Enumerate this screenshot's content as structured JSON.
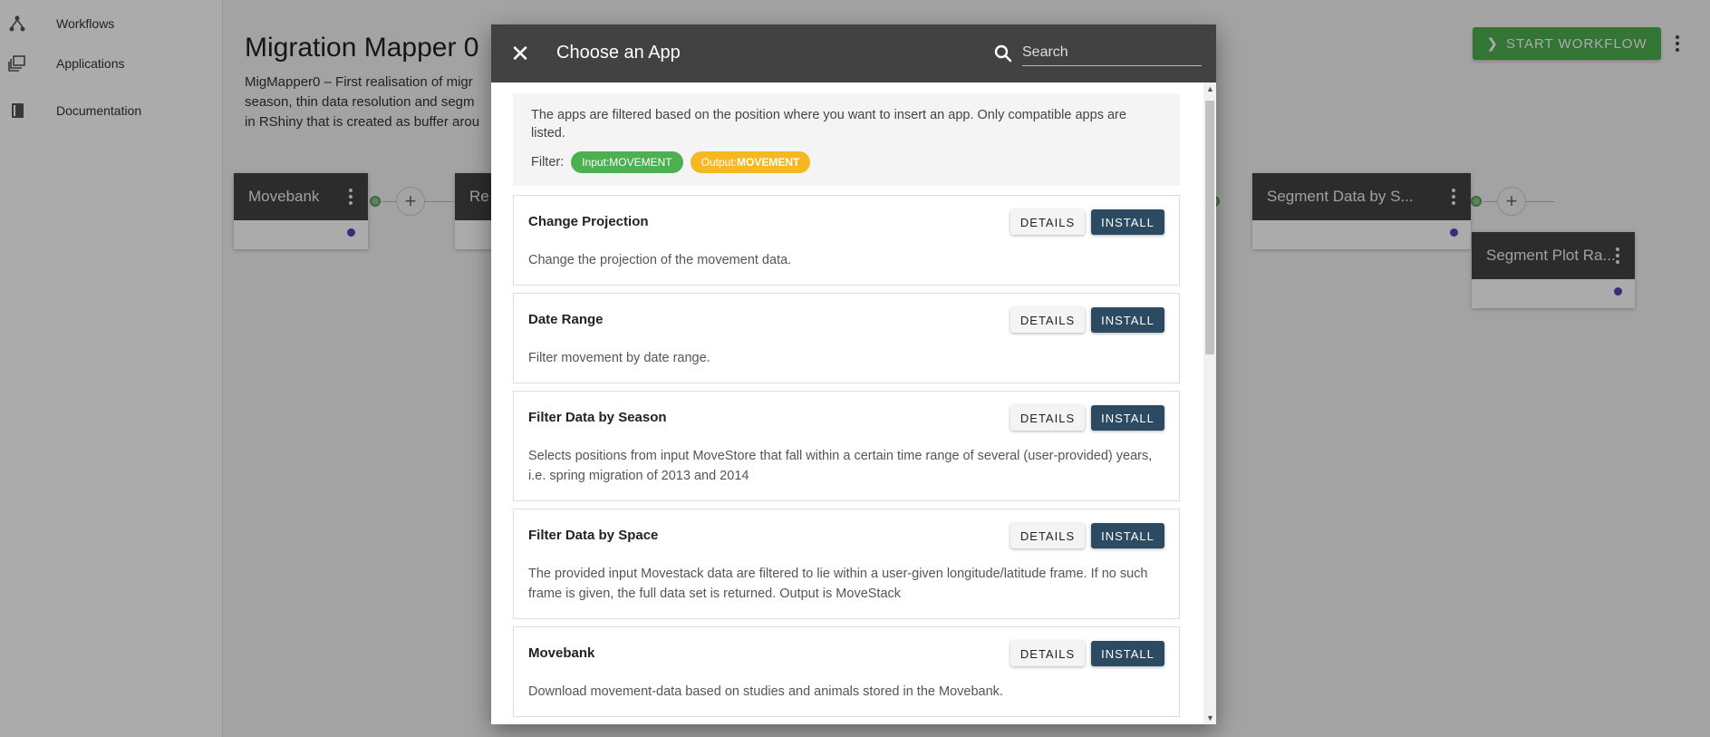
{
  "sidebar": {
    "items": [
      {
        "label": "Workflows",
        "icon": "workflow-icon"
      },
      {
        "label": "Applications",
        "icon": "applications-icon"
      },
      {
        "label": "Documentation",
        "icon": "book-icon"
      }
    ]
  },
  "main": {
    "title": "Migration Mapper 0",
    "description_lines": [
      "MigMapper0 – First realisation of migr",
      "season, thin data resolution and segm",
      "in RShiny that is created as buffer arou"
    ],
    "start_button": "START WORKFLOW",
    "nodes": [
      {
        "title": "Movebank"
      },
      {
        "title": "Re"
      },
      {
        "title": "Segment Data by S..."
      },
      {
        "title": "Segment Plot Ra..."
      }
    ]
  },
  "modal": {
    "title": "Choose an App",
    "search_placeholder": "Search",
    "info_text": "The apps are filtered based on the position where you want to insert an app. Only compatible apps are listed.",
    "filter_label": "Filter:",
    "chips": {
      "input_prefix": "Input: ",
      "input_value": "MOVEMENT",
      "output_prefix": "Output:",
      "output_value": "MOVEMENT"
    },
    "details_label": "DETAILS",
    "install_label": "INSTALL",
    "apps": [
      {
        "name": "Change Projection",
        "description": "Change the projection of the movement data."
      },
      {
        "name": "Date Range",
        "description": "Filter movement by date range."
      },
      {
        "name": "Filter Data by Season",
        "description": "Selects positions from input MoveStore that fall within a certain time range of several (user-provided) years, i.e. spring migration of 2013 and 2014"
      },
      {
        "name": "Filter Data by Space",
        "description": "The provided input Movestack data are filtered to lie within a user-given longitude/latitude frame. If no such frame is given, the full data set is returned. Output is MoveStack"
      },
      {
        "name": "Movebank",
        "description": "Download movement-data based on studies and animals stored in the Movebank."
      }
    ]
  },
  "colors": {
    "header_dark": "#424242",
    "install_button": "#2c4a62",
    "start_button": "#4caf50",
    "input_chip": "#4caf50",
    "output_chip": "#f5b820",
    "node_port": "#5b3fb8"
  }
}
